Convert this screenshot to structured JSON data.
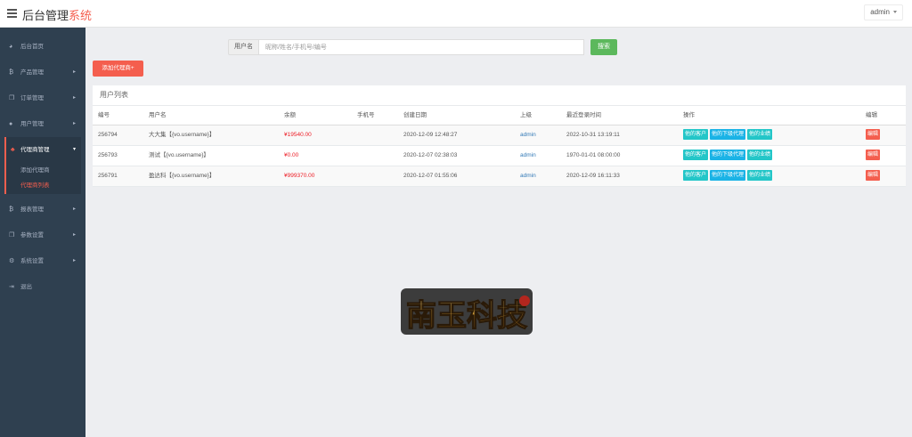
{
  "header": {
    "brand_main": "后台管理",
    "brand_accent": "系统",
    "user": "admin"
  },
  "sidebar": {
    "items": [
      {
        "label": "后台首页",
        "icon": "dashboard-icon",
        "glyph": "◕"
      },
      {
        "label": "产品管理",
        "icon": "bitcoin-icon",
        "glyph": "₿"
      },
      {
        "label": "订单管理",
        "icon": "copy-icon",
        "glyph": "❐"
      },
      {
        "label": "用户管理",
        "icon": "user-icon",
        "glyph": "●"
      },
      {
        "label": "代理商管理",
        "icon": "agent-icon",
        "glyph": "♣"
      },
      {
        "label": "报表管理",
        "icon": "bitcoin-icon",
        "glyph": "₿"
      },
      {
        "label": "参数设置",
        "icon": "copy-icon",
        "glyph": "❐"
      },
      {
        "label": "系统设置",
        "icon": "gears-icon",
        "glyph": "⚙"
      },
      {
        "label": "退出",
        "icon": "signout-icon",
        "glyph": "⇥"
      }
    ],
    "sub_items": [
      "添加代理商",
      "代理商列表"
    ]
  },
  "search": {
    "label": "用户名",
    "placeholder": "昵称/姓名/手机号/编号",
    "button": "搜索"
  },
  "add_button": "添加代理商+",
  "panel": {
    "title": "用户列表",
    "columns": [
      "编号",
      "用户名",
      "余额",
      "手机号",
      "创建日期",
      "上级",
      "最近登录时间",
      "操作",
      "编辑"
    ],
    "rows": [
      {
        "id": "256794",
        "name": "大大集【{vo.username}】",
        "balance": "¥19540.00",
        "phone": "",
        "created": "2020-12-09 12:48:27",
        "parent": "admin",
        "last_login": "2022-10-31 13:19:11"
      },
      {
        "id": "256793",
        "name": "测试【{vo.username}】",
        "balance": "¥0.00",
        "phone": "",
        "created": "2020-12-07 02:38:03",
        "parent": "admin",
        "last_login": "1970-01-01 08:00:00"
      },
      {
        "id": "256791",
        "name": "盈达科【{vo.username}】",
        "balance": "¥999370.00",
        "phone": "",
        "created": "2020-12-07 01:55:06",
        "parent": "admin",
        "last_login": "2020-12-09 16:11:33"
      }
    ],
    "actions": [
      "他的客户",
      "他的下级代理",
      "他的业绩"
    ],
    "edit": "编辑"
  },
  "logo_text": "南玉科技",
  "colors": {
    "accent": "#f45e4e",
    "sidebar": "#2f4050",
    "search": "#5cb85c",
    "teal": "#23c6c8",
    "money": "#ed1b24"
  }
}
